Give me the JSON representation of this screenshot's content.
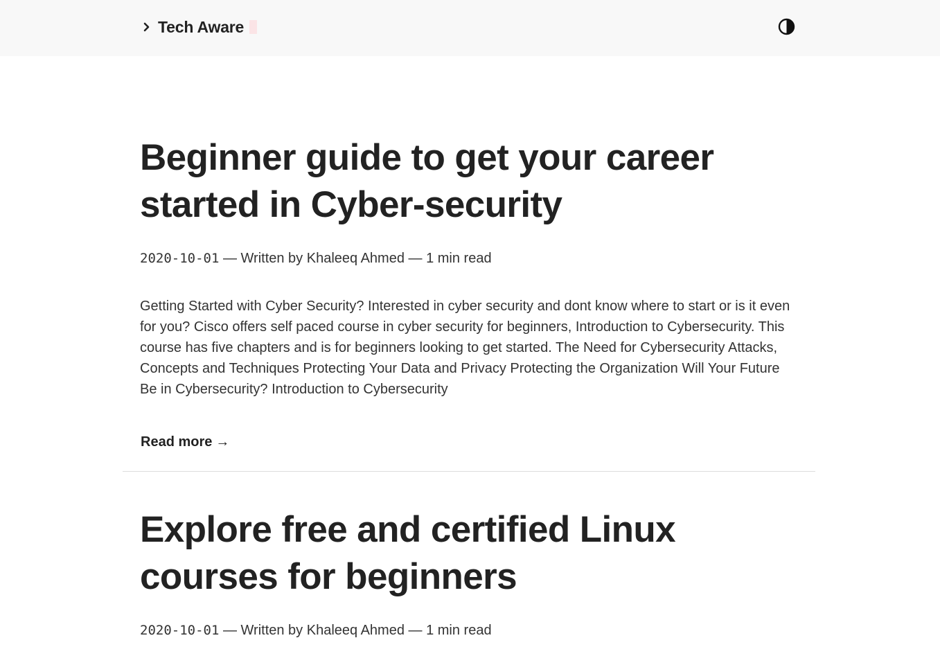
{
  "header": {
    "brand_prefix_icon": "chevron-right-icon",
    "brand_name": "Tech Aware",
    "theme_toggle_icon": "contrast-half-circle-icon"
  },
  "posts": [
    {
      "title": "Beginner guide to get your career started in Cyber-security",
      "date": "2020-10-01",
      "sep1": " — ",
      "author_text": "Written by Khaleeq Ahmed",
      "sep2": " — ",
      "read_time": "1 min read",
      "excerpt": "Getting Started with Cyber Security? Interested in cyber security and dont know where to start or is it even for you? Cisco offers self paced course in cyber security for beginners, Introduction to Cybersecurity. This course has five chapters and is for beginners looking to get started. The Need for Cybersecurity Attacks, Concepts and Techniques Protecting Your Data and Privacy Protecting the Organization Will Your Future Be in Cybersecurity? Introduction to Cybersecurity",
      "read_more": "Read more",
      "read_more_arrow": "→"
    },
    {
      "title": "Explore free and certified Linux courses for beginners",
      "date": "2020-10-01",
      "sep1": " — ",
      "author_text": "Written by Khaleeq Ahmed",
      "sep2": " — ",
      "read_time": "1 min read"
    }
  ]
}
